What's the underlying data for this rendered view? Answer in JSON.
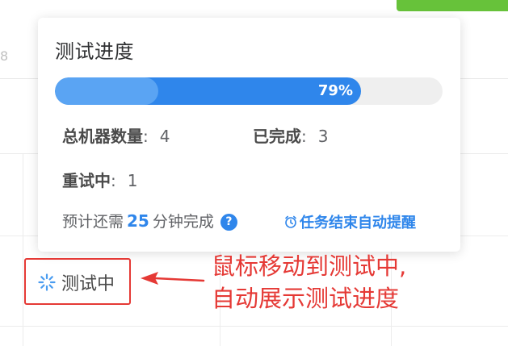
{
  "popover": {
    "title": "测试进度",
    "progress_value": 0.79,
    "progress_text": "79%",
    "stats": {
      "total_label": "总机器数量",
      "total_colon": ":",
      "total_value": "4",
      "done_label": "已完成",
      "done_colon": ":",
      "done_value": "3",
      "retry_label": "重试中",
      "retry_colon": ":",
      "retry_value": "1"
    },
    "estimate": {
      "prefix": "预计还需",
      "minutes": "25",
      "suffix": "分钟完成",
      "help_glyph": "?"
    },
    "remind_label": "任务结束自动提醒"
  },
  "status_cell": {
    "label": "测试中",
    "icon": "loading-spinner-icon"
  },
  "annotation": {
    "line1": "鼠标移动到测试中,",
    "line2": "自动展示测试进度"
  },
  "colors": {
    "accent": "#2f86eb",
    "annotation": "#e53935",
    "green_button": "#67c23a"
  }
}
